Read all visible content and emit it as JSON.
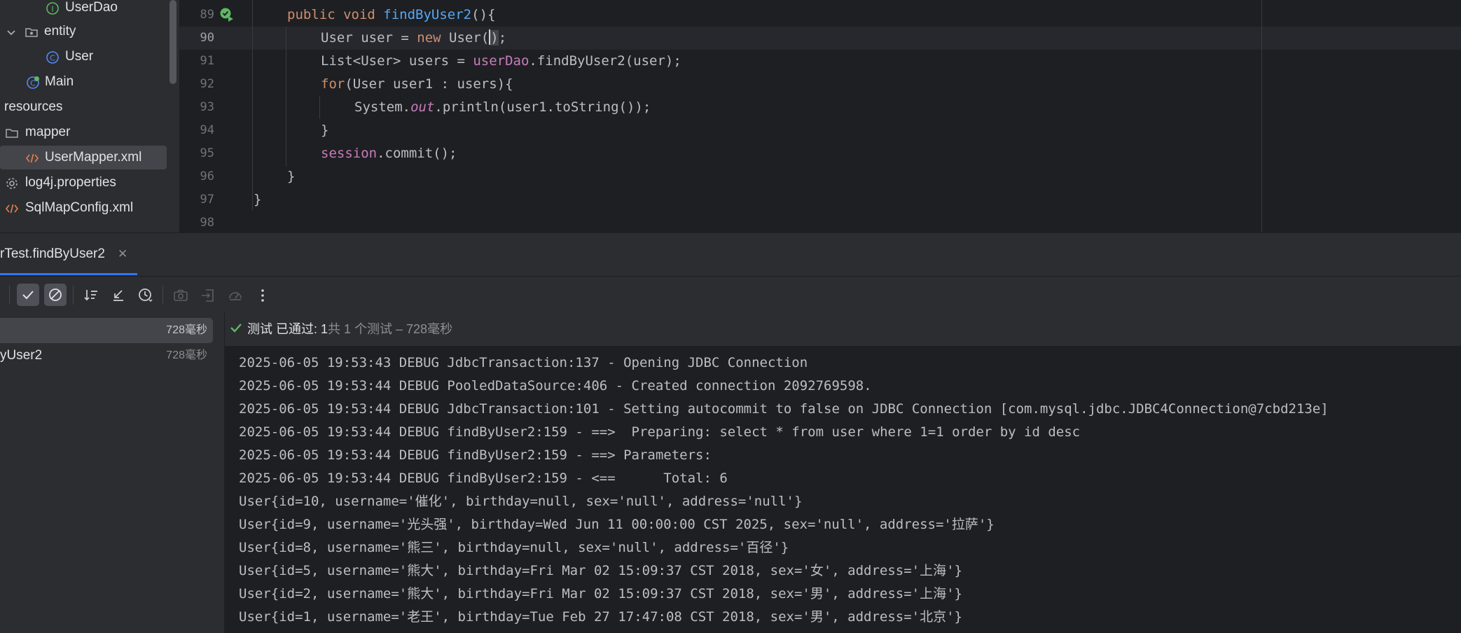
{
  "project_tree": {
    "items": [
      {
        "label": "UserDao",
        "icon": "interface-icon"
      },
      {
        "label": "entity",
        "icon": "folder-icon",
        "expanded": true
      },
      {
        "label": "User",
        "icon": "class-icon"
      },
      {
        "label": "Main",
        "icon": "test-class-icon"
      },
      {
        "label": "resources",
        "icon": "none"
      },
      {
        "label": "mapper",
        "icon": "folder-icon"
      },
      {
        "label": "UserMapper.xml",
        "icon": "xml-icon",
        "selected": true
      },
      {
        "label": "log4j.properties",
        "icon": "gear-icon"
      },
      {
        "label": "SqlMapConfig.xml",
        "icon": "xml-icon"
      }
    ]
  },
  "editor": {
    "line_numbers": [
      "89",
      "90",
      "91",
      "92",
      "93",
      "94",
      "95",
      "96",
      "97",
      "98"
    ],
    "current_line": "90",
    "code": {
      "l89_kw": "public void ",
      "l89_fn": "findByUser2",
      "l89_rest": "(){",
      "l90_a": "User user = ",
      "l90_kw": "new",
      "l90_b": " User(",
      "l90_c": ")",
      "l90_d": ";",
      "l91_a": "List<User> users = ",
      "l91_field": "userDao",
      "l91_b": ".findByUser2(user);",
      "l92_kw": "for",
      "l92_b": "(User user1 : users){",
      "l93_a": "System.",
      "l93_static": "out",
      "l93_b": ".println(user1.toString());",
      "l94": "}",
      "l95_field": "session",
      "l95_b": ".commit();",
      "l96": "}",
      "l97": "}"
    }
  },
  "run_window": {
    "tab_label": "rTest.findByUser2",
    "tab_close": "✕",
    "tests": [
      {
        "label": "",
        "time": "728毫秒",
        "selected": true
      },
      {
        "label": "yUser2",
        "time": "728毫秒",
        "selected": false
      }
    ],
    "status": {
      "prefix": "测试 已通过: 1",
      "detail": "共 1 个测试 – 728毫秒"
    },
    "log_lines": [
      "2025-06-05 19:53:43 DEBUG JdbcTransaction:137 - Opening JDBC Connection",
      "2025-06-05 19:53:44 DEBUG PooledDataSource:406 - Created connection 2092769598.",
      "2025-06-05 19:53:44 DEBUG JdbcTransaction:101 - Setting autocommit to false on JDBC Connection [com.mysql.jdbc.JDBC4Connection@7cbd213e]",
      "2025-06-05 19:53:44 DEBUG findByUser2:159 - ==>  Preparing: select * from user where 1=1 order by id desc",
      "2025-06-05 19:53:44 DEBUG findByUser2:159 - ==> Parameters: ",
      "2025-06-05 19:53:44 DEBUG findByUser2:159 - <==      Total: 6",
      "User{id=10, username='催化', birthday=null, sex='null', address='null'}",
      "User{id=9, username='光头强', birthday=Wed Jun 11 00:00:00 CST 2025, sex='null', address='拉萨'}",
      "User{id=8, username='熊三', birthday=null, sex='null', address='百径'}",
      "User{id=5, username='熊大', birthday=Fri Mar 02 15:09:37 CST 2018, sex='女', address='上海'}",
      "User{id=2, username='熊大', birthday=Fri Mar 02 15:09:37 CST 2018, sex='男', address='上海'}",
      "User{id=1, username='老王', birthday=Tue Feb 27 17:47:08 CST 2018, sex='男', address='北京'}"
    ]
  },
  "colors": {
    "accent": "#3574f0",
    "success": "#5fb865",
    "keyword": "#cf8e6d",
    "function": "#56a8f5",
    "field": "#c77dbb"
  }
}
